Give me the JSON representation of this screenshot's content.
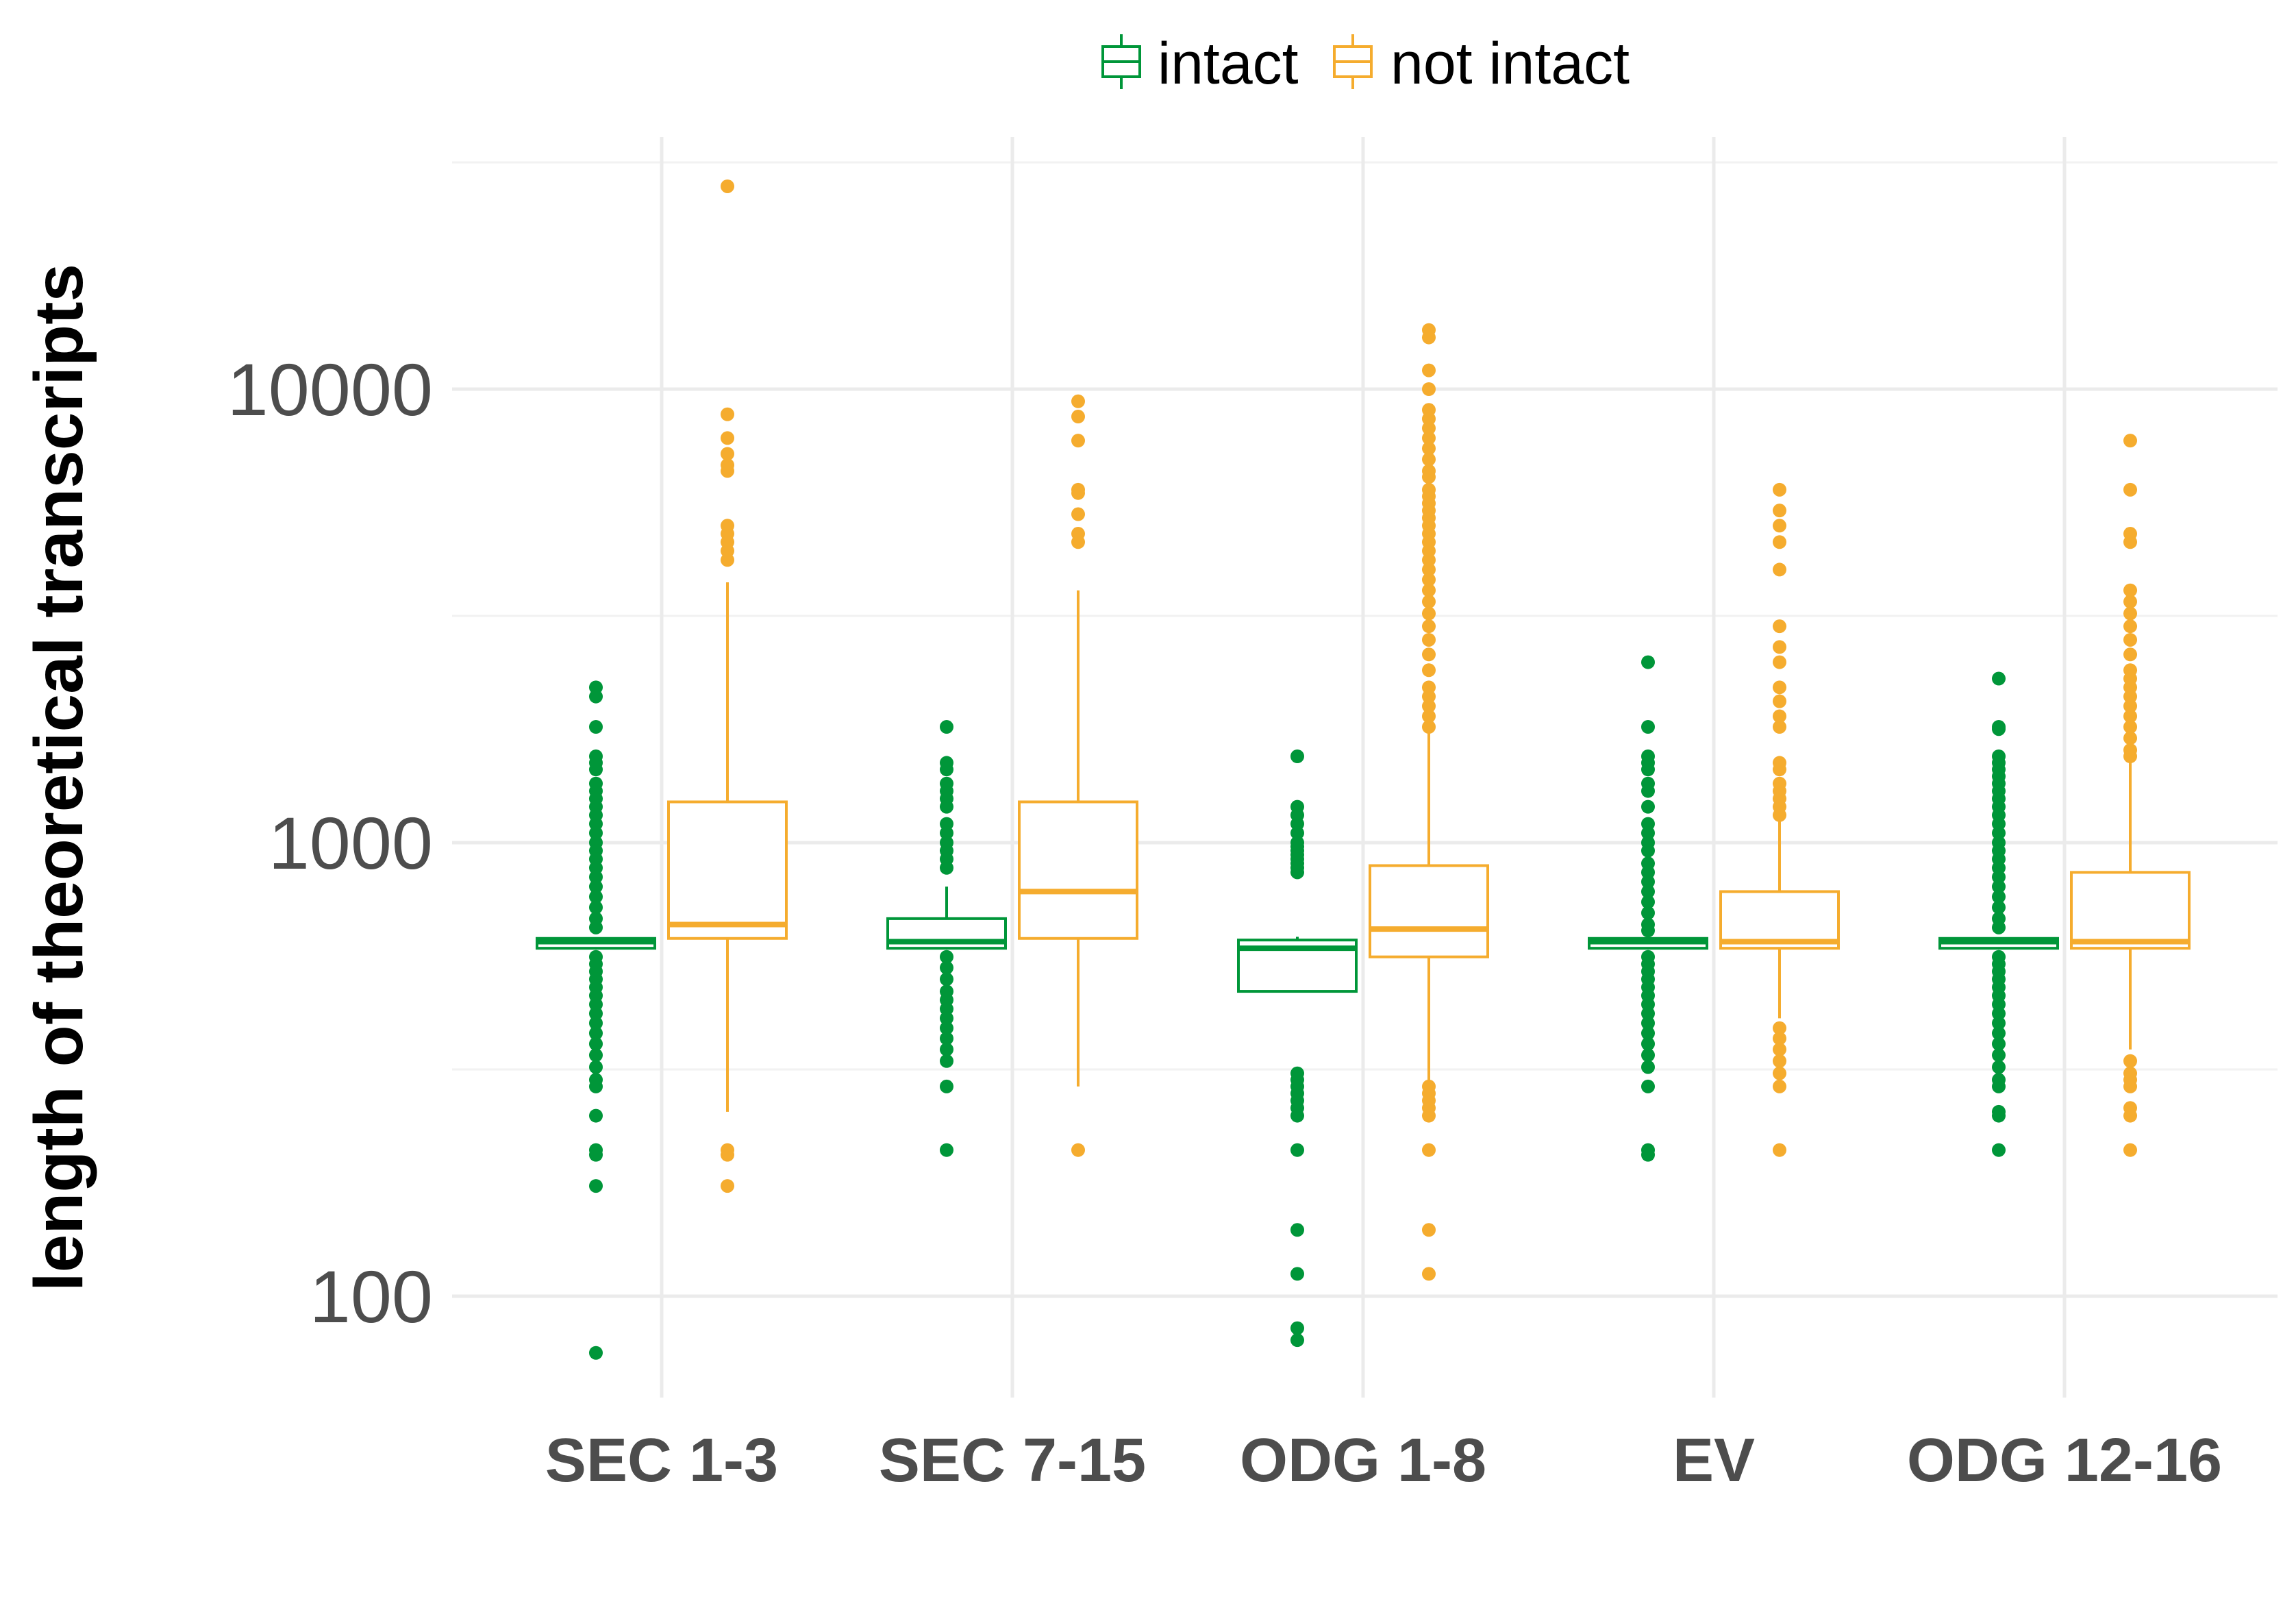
{
  "chart_data": {
    "type": "boxplot",
    "title": "",
    "xlabel": "",
    "ylabel": "length of theoretical transcripts",
    "y_scale": "log10",
    "ylim": [
      60,
      35000
    ],
    "y_ticks": [
      {
        "value": 100,
        "label": "100"
      },
      {
        "value": 1000,
        "label": "1000"
      },
      {
        "value": 10000,
        "label": "10000"
      }
    ],
    "grid": true,
    "legend": {
      "position": "top",
      "entries": [
        "intact",
        "not intact"
      ]
    },
    "categories": [
      "SEC 1-3",
      "SEC 7-15",
      "ODG 1-8",
      "EV",
      "ODG 12-16"
    ],
    "series": [
      {
        "name": "intact",
        "color": "#009639",
        "boxes": [
          {
            "lower_whisker": 585,
            "q1": 585,
            "median": 605,
            "q3": 615,
            "upper_whisker": 615,
            "outliers": [
              2200,
              2100,
              1800,
              1550,
              1500,
              1450,
              1350,
              1300,
              1250,
              1200,
              1150,
              1100,
              1050,
              1000,
              960,
              920,
              880,
              840,
              800,
              760,
              720,
              680,
              650,
              560,
              540,
              520,
              500,
              480,
              460,
              440,
              420,
              400,
              380,
              360,
              340,
              320,
              300,
              290,
              250,
              210,
              205,
              175,
              75
            ]
          },
          {
            "lower_whisker": 585,
            "q1": 585,
            "median": 605,
            "q3": 680,
            "upper_whisker": 800,
            "outliers": [
              1800,
              1500,
              1450,
              1350,
              1300,
              1250,
              1200,
              1100,
              1050,
              1000,
              960,
              920,
              880,
              560,
              530,
              500,
              470,
              450,
              430,
              410,
              390,
              370,
              350,
              330,
              290,
              210
            ]
          },
          {
            "lower_whisker": 480,
            "q1": 470,
            "median": 585,
            "q3": 610,
            "upper_whisker": 620,
            "outliers": [
              1550,
              1200,
              1150,
              1100,
              1050,
              1000,
              980,
              960,
              940,
              920,
              900,
              880,
              860,
              310,
              300,
              290,
              280,
              270,
              260,
              250,
              210,
              140,
              112,
              85,
              80
            ]
          },
          {
            "lower_whisker": 585,
            "q1": 585,
            "median": 605,
            "q3": 615,
            "upper_whisker": 615,
            "outliers": [
              2500,
              1800,
              1550,
              1500,
              1450,
              1350,
              1300,
              1200,
              1100,
              1050,
              1000,
              960,
              900,
              860,
              820,
              780,
              740,
              700,
              660,
              640,
              560,
              540,
              520,
              500,
              480,
              460,
              440,
              420,
              400,
              380,
              360,
              340,
              320,
              290,
              210,
              205
            ]
          },
          {
            "lower_whisker": 585,
            "q1": 585,
            "median": 605,
            "q3": 615,
            "upper_whisker": 615,
            "outliers": [
              2300,
              1800,
              1780,
              1550,
              1500,
              1450,
              1400,
              1350,
              1300,
              1250,
              1200,
              1150,
              1100,
              1050,
              1000,
              960,
              920,
              880,
              840,
              800,
              760,
              720,
              680,
              650,
              560,
              540,
              520,
              500,
              480,
              460,
              440,
              420,
              400,
              380,
              360,
              340,
              320,
              300,
              290,
              255,
              250,
              210
            ]
          }
        ]
      },
      {
        "name": "not intact",
        "color": "#f5ac2e",
        "boxes": [
          {
            "lower_whisker": 255,
            "q1": 615,
            "median": 660,
            "q3": 1230,
            "upper_whisker": 3750,
            "outliers": [
              28000,
              8800,
              7800,
              7200,
              6800,
              6600,
              5000,
              4800,
              4600,
              4400,
              4200,
              210,
              205,
              175
            ]
          },
          {
            "lower_whisker": 290,
            "q1": 615,
            "median": 780,
            "q3": 1230,
            "upper_whisker": 3600,
            "outliers": [
              9400,
              8700,
              7700,
              6000,
              5900,
              5300,
              4800,
              4600,
              210
            ]
          },
          {
            "lower_whisker": 265,
            "q1": 560,
            "median": 645,
            "q3": 890,
            "upper_whisker": 1750,
            "outliers": [
              13500,
              13000,
              11000,
              10000,
              9000,
              8600,
              8200,
              7800,
              7400,
              7000,
              6600,
              6400,
              6000,
              5800,
              5600,
              5400,
              5200,
              5000,
              4800,
              4600,
              4400,
              4200,
              4000,
              3800,
              3600,
              3400,
              3200,
              3000,
              2800,
              2600,
              2400,
              2200,
              2100,
              2000,
              1900,
              1800,
              290,
              280,
              270,
              260,
              250,
              210,
              140,
              112
            ]
          },
          {
            "lower_whisker": 410,
            "q1": 585,
            "median": 605,
            "q3": 780,
            "upper_whisker": 1120,
            "outliers": [
              6000,
              5400,
              5000,
              4600,
              4000,
              3000,
              2700,
              2500,
              2200,
              2050,
              1900,
              1800,
              1500,
              1450,
              1350,
              1300,
              1250,
              1200,
              1150,
              390,
              370,
              350,
              330,
              310,
              290,
              210
            ]
          },
          {
            "lower_whisker": 350,
            "q1": 585,
            "median": 605,
            "q3": 860,
            "upper_whisker": 1500,
            "outliers": [
              7700,
              6000,
              4800,
              4600,
              3600,
              3400,
              3200,
              3000,
              2800,
              2600,
              2400,
              2300,
              2200,
              2100,
              2000,
              1900,
              1800,
              1700,
              1600,
              1550,
              330,
              310,
              300,
              290,
              260,
              250,
              210
            ]
          }
        ]
      }
    ]
  }
}
